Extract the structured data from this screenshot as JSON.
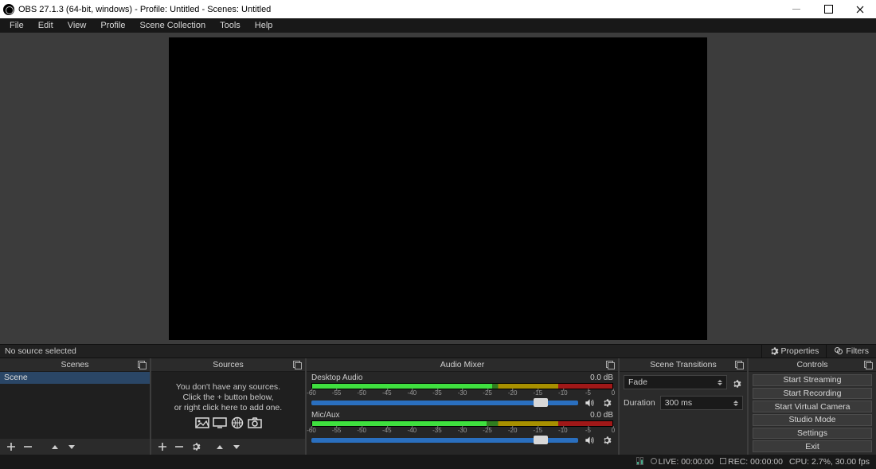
{
  "title": "OBS 27.1.3 (64-bit, windows) - Profile: Untitled - Scenes: Untitled",
  "menu": {
    "file": "File",
    "edit": "Edit",
    "view": "View",
    "profile": "Profile",
    "scene_collection": "Scene Collection",
    "tools": "Tools",
    "help": "Help"
  },
  "toolbar": {
    "no_source": "No source selected",
    "properties": "Properties",
    "filters": "Filters"
  },
  "docks": {
    "scenes": "Scenes",
    "sources": "Sources",
    "mixer": "Audio Mixer",
    "transitions": "Scene Transitions",
    "controls": "Controls"
  },
  "scenes": {
    "item0": "Scene"
  },
  "sources_empty": {
    "l1": "You don't have any sources.",
    "l2": "Click the + button below,",
    "l3": "or right click here to add one."
  },
  "mixer": {
    "ch0_name": "Desktop Audio",
    "ch0_db": "0.0 dB",
    "ch1_name": "Mic/Aux",
    "ch1_db": "0.0 dB",
    "ticks": [
      "-60",
      "-55",
      "-50",
      "-45",
      "-40",
      "-35",
      "-30",
      "-25",
      "-20",
      "-15",
      "-10",
      "-5",
      "0"
    ]
  },
  "transitions": {
    "selected": "Fade",
    "duration_label": "Duration",
    "duration_value": "300 ms"
  },
  "controls": {
    "b0": "Start Streaming",
    "b1": "Start Recording",
    "b2": "Start Virtual Camera",
    "b3": "Studio Mode",
    "b4": "Settings",
    "b5": "Exit"
  },
  "status": {
    "live": "LIVE: 00:00:00",
    "rec": "REC: 00:00:00",
    "cpu": "CPU: 2.7%, 30.00 fps"
  }
}
